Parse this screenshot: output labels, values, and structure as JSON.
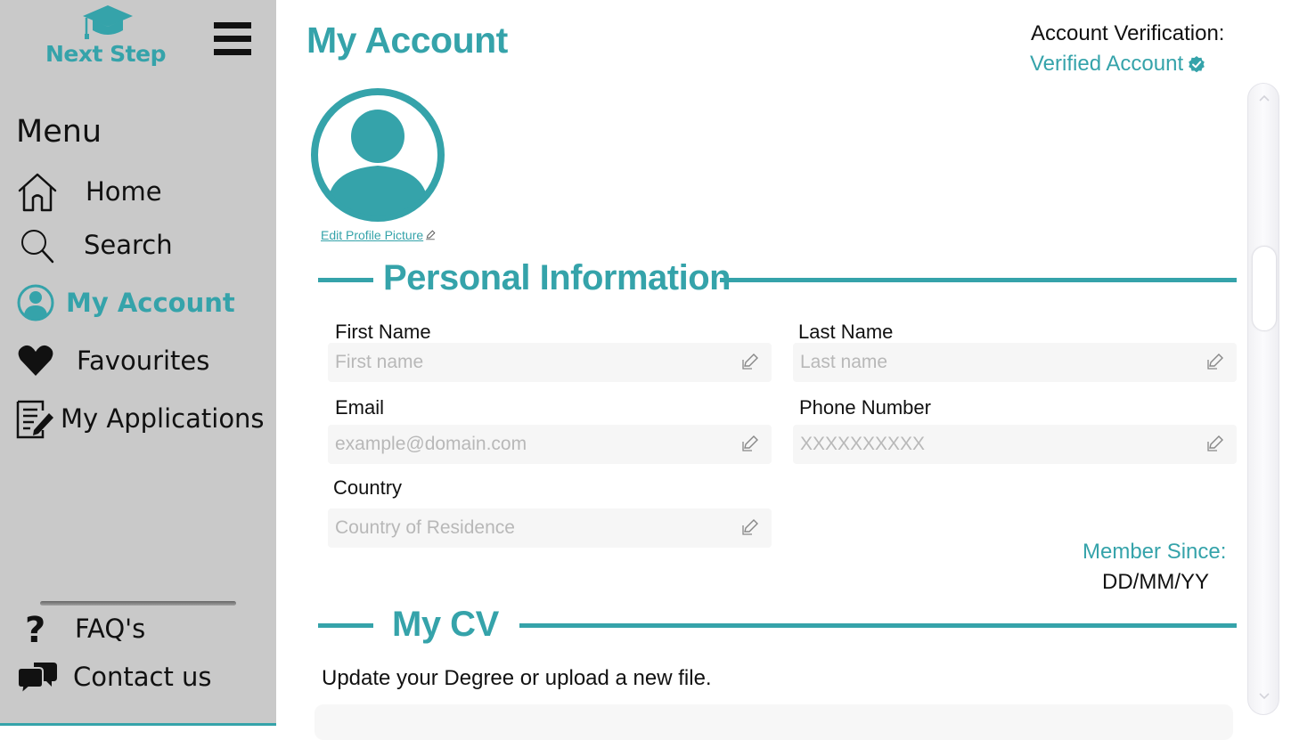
{
  "app": {
    "logo_text": "Next Step"
  },
  "sidebar": {
    "menu_title": "Menu",
    "items": [
      {
        "label": "Home",
        "icon": "home-icon"
      },
      {
        "label": "Search",
        "icon": "search-icon"
      },
      {
        "label": "My Account",
        "icon": "account-icon",
        "active": true
      },
      {
        "label": "Favourites",
        "icon": "heart-icon"
      },
      {
        "label": "My Applications",
        "icon": "applications-icon"
      }
    ],
    "bottom_items": [
      {
        "label": "FAQ's",
        "icon": "question-icon"
      },
      {
        "label": "Contact us",
        "icon": "chat-icon"
      }
    ]
  },
  "header": {
    "title": "My Account",
    "verification_label": "Account Verification:",
    "verification_value": "Verified Account"
  },
  "profile": {
    "edit_picture_label": "Edit Profile Picture"
  },
  "personal_info": {
    "section_title": "Personal Information",
    "fields": {
      "first_name": {
        "label": "First Name",
        "placeholder": "First name",
        "value": ""
      },
      "last_name": {
        "label": "Last Name",
        "placeholder": "Last name",
        "value": ""
      },
      "email": {
        "label": "Email",
        "placeholder": "example@domain.com",
        "value": ""
      },
      "phone": {
        "label": "Phone Number",
        "placeholder": "XXXXXXXXXX",
        "value": ""
      },
      "country": {
        "label": "Country",
        "placeholder": "Country of Residence",
        "value": ""
      }
    },
    "member_since_label": "Member Since:",
    "member_since_value": "DD/MM/YY"
  },
  "cv": {
    "section_title": "My CV",
    "description": "Update your Degree or upload a new file."
  },
  "colors": {
    "accent": "#35a3aa",
    "sidebar_bg": "#c9c9c9",
    "field_bg": "#f6f6f6"
  }
}
